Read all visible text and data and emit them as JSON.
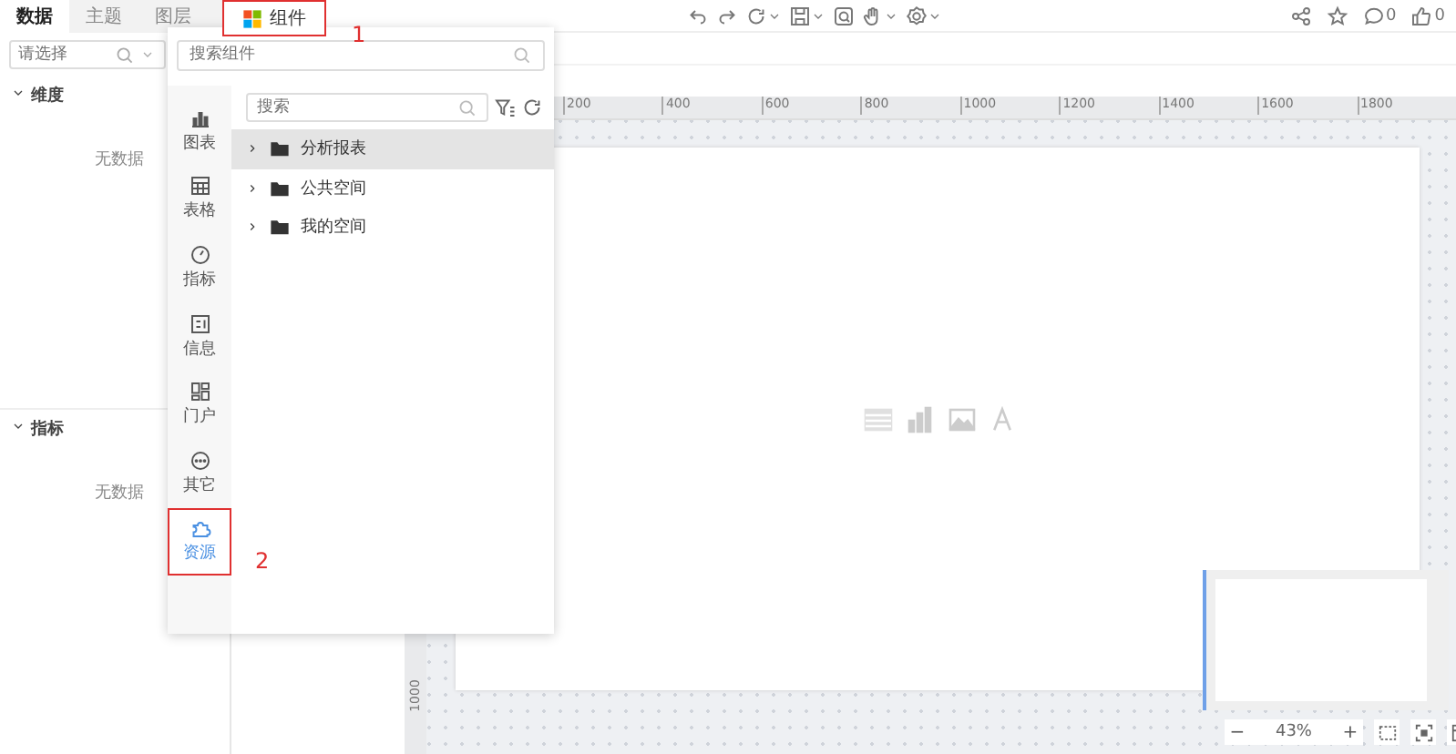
{
  "left_tabs": [
    {
      "label": "数据",
      "selected": true
    },
    {
      "label": "主题",
      "selected": false
    },
    {
      "label": "图层",
      "selected": false
    }
  ],
  "component_tab": {
    "label": "组件"
  },
  "field_select": {
    "placeholder": "请选择"
  },
  "sections": [
    {
      "title": "维度",
      "expanded": true,
      "empty_text": "无数据"
    },
    {
      "title": "指标",
      "expanded": true,
      "empty_text": "无数据"
    }
  ],
  "toolbar": {
    "comment_count": "0",
    "like_count": "0"
  },
  "popup": {
    "search": {
      "placeholder": "搜索组件"
    },
    "categories": [
      {
        "kind": "chart",
        "label": "图表",
        "selected": false
      },
      {
        "kind": "table",
        "label": "表格",
        "selected": false
      },
      {
        "kind": "gauge",
        "label": "指标",
        "selected": false
      },
      {
        "kind": "info",
        "label": "信息",
        "selected": false
      },
      {
        "kind": "portal",
        "label": "门户",
        "selected": false
      },
      {
        "kind": "other",
        "label": "其它",
        "selected": false
      },
      {
        "kind": "resource",
        "label": "资源",
        "selected": true
      }
    ],
    "resource_search": {
      "placeholder": "搜索"
    },
    "tree": [
      {
        "label": "分析报表",
        "selected": true
      },
      {
        "label": "公共空间",
        "selected": false
      },
      {
        "label": "我的空间",
        "selected": false
      }
    ]
  },
  "ruler": {
    "x_labels": [
      "200",
      "400",
      "600",
      "800",
      "1000",
      "1200",
      "1400",
      "1600",
      "1800"
    ],
    "y_labels": [
      "1000"
    ]
  },
  "zoom": {
    "minus": "−",
    "value": "43%",
    "plus": "+"
  },
  "annotations": [
    {
      "label": "1"
    },
    {
      "label": "2"
    }
  ]
}
